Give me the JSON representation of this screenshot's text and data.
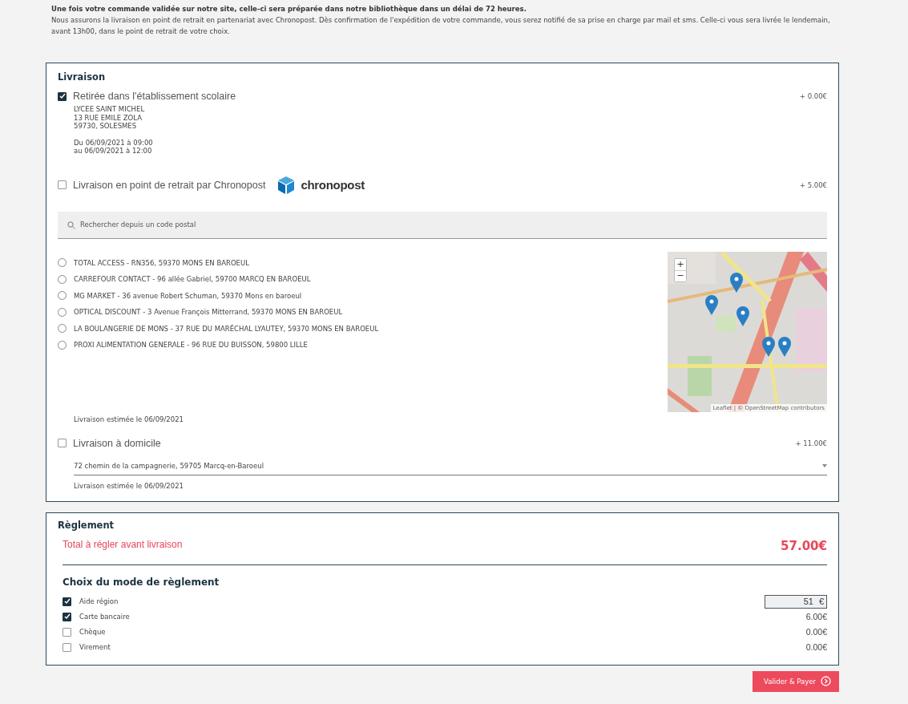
{
  "intro": [
    "Une fois votre commande validée sur notre site, celle-ci sera préparée dans notre bibliothèque dans un délai de 72 heures.",
    "Nous assurons la livraison en point de retrait en partenariat avec Chronopost. Dès confirmation de l'expédition de votre commande, vous serez notifié de sa prise en charge par mail et sms. Celle-ci vous sera livrée le lendemain, avant 13h00, dans le point de retrait de votre choix."
  ],
  "delivery": {
    "title": "Livraison",
    "options": [
      {
        "kind": "school",
        "label": "Retirée dans l'établissement scolaire",
        "checked": true,
        "price": "+ 0.00€",
        "address": [
          "LYCEE SAINT MICHEL",
          "13 RUE EMILE ZOLA",
          "59730, SOLESMES"
        ],
        "schedule": [
          "Du 06/09/2021 à 09:00",
          "au 06/09/2021 à 12:00"
        ]
      },
      {
        "kind": "relay",
        "label": "Livraison en point de retrait par Chronopost",
        "checked": false,
        "price": "+ 5.00€",
        "logo": "chronopost",
        "search": {
          "placeholder": "Rechercher depuis un code postal"
        },
        "points": [
          {
            "label": "TOTAL ACCESS - RN356, 59370 MONS EN BAROEUL",
            "selected": false
          },
          {
            "label": "CARREFOUR CONTACT - 96 allée Gabriel, 59700 MARCQ EN BAROEUL",
            "selected": false
          },
          {
            "label": "MG MARKET - 36 avenue Robert Schuman, 59370 Mons en baroeul",
            "selected": false
          },
          {
            "label": "OPTICAL DISCOUNT - 3 Avenue François Mitterrand, 59370 MONS EN BAROEUL",
            "selected": false
          },
          {
            "label": "LA BOULANGERIE DE MONS - 37 RUE DU MARÉCHAL LYAUTEY, 59370 MONS EN BAROEUL",
            "selected": false
          },
          {
            "label": "PROXI ALIMENTATION GENERALE - 96 RUE DU BUISSON, 59800 LILLE",
            "selected": false
          }
        ],
        "map": {
          "zoom_in": "+",
          "zoom_out": "−",
          "attribution": "Leaflet | © OpenStreetMap contributors"
        },
        "estimate": "Livraison estimée le 06/09/2021"
      },
      {
        "kind": "home",
        "label": "Livraison à domicile",
        "checked": false,
        "price": "+ 11.00€",
        "address_select": "72 chemin de la campagnerie, 59705 Marcq-en-Baroeul",
        "estimate": "Livraison estimée le 06/09/2021"
      }
    ]
  },
  "payment": {
    "title": "Règlement",
    "total_label": "Total à régler avant livraison",
    "total": "57.00€",
    "methods_title": "Choix du mode de règlement",
    "methods": [
      {
        "label": "Aide région",
        "checked": true,
        "kind": "input",
        "amount": "51",
        "currency": "€"
      },
      {
        "label": "Carte bancaire",
        "checked": true,
        "kind": "amount",
        "amount": "6.00€"
      },
      {
        "label": "Chèque",
        "checked": false,
        "kind": "amount",
        "amount": "0.00€"
      },
      {
        "label": "Virement",
        "checked": false,
        "kind": "amount",
        "amount": "0.00€"
      }
    ]
  },
  "submit": "Valider & Payer"
}
